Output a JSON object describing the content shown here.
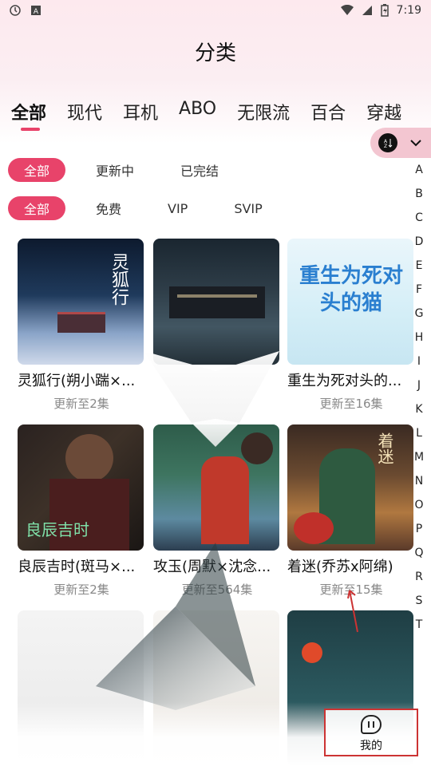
{
  "status": {
    "time": "7:19"
  },
  "page_title": "分类",
  "categories": [
    "全部",
    "现代",
    "耳机",
    "ABO",
    "无限流",
    "百合",
    "穿越"
  ],
  "filters_status": [
    "全部",
    "更新中",
    "已完结"
  ],
  "filters_price": [
    "全部",
    "免费",
    "VIP",
    "SVIP"
  ],
  "alphabet": [
    "A",
    "B",
    "C",
    "D",
    "E",
    "F",
    "G",
    "H",
    "I",
    "J",
    "K",
    "L",
    "M",
    "N",
    "O",
    "P",
    "Q",
    "R",
    "S",
    "T"
  ],
  "cards": [
    {
      "title": "灵狐行(朔小踹×...",
      "subtitle": "更新至2集",
      "cover_text": "灵狐行"
    },
    {
      "title": "",
      "subtitle": "",
      "cover_text": ""
    },
    {
      "title": "重生为死对头的...",
      "subtitle": "更新至16集",
      "cover_text": "重生为死对头的猫"
    },
    {
      "title": "良辰吉时(斑马×...",
      "subtitle": "更新至2集",
      "cover_text": "良辰吉时"
    },
    {
      "title": "攻玉(周默×沈念...",
      "subtitle": "更新至564集",
      "cover_text": ""
    },
    {
      "title": "着迷(乔苏x阿绵)",
      "subtitle": "更新至15集",
      "cover_text": "着迷"
    }
  ],
  "bottom_nav": {
    "mine_label": "我的"
  },
  "colors": {
    "accent": "#e8436a",
    "pill": "#f3c6d1"
  }
}
